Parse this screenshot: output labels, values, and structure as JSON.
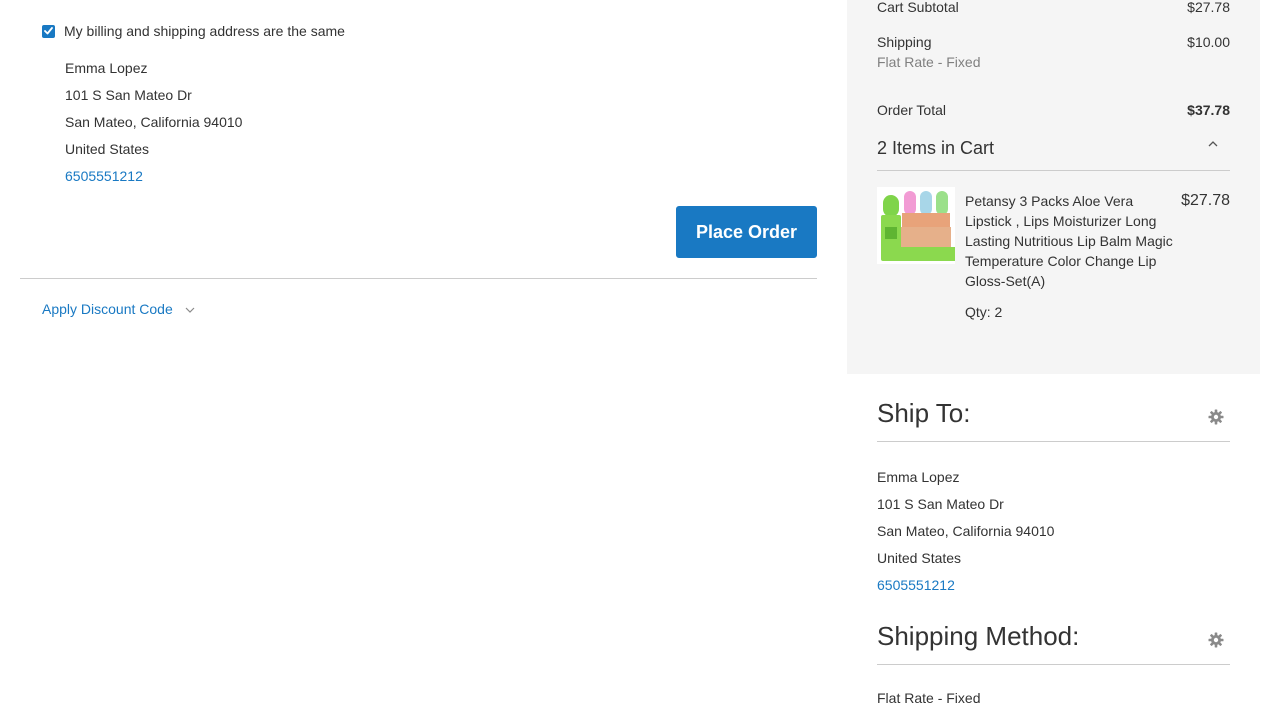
{
  "billing": {
    "same_address_label": "My billing and shipping address are the same",
    "address": {
      "name": "Emma Lopez",
      "street": "101 S San Mateo Dr",
      "city_line": "San Mateo, California 94010",
      "country": "United States",
      "phone": "6505551212"
    }
  },
  "actions": {
    "place_order_label": "Place Order",
    "discount_label": "Apply Discount Code"
  },
  "summary": {
    "subtotal_label": "Cart Subtotal",
    "subtotal_value": "$27.78",
    "shipping_label": "Shipping",
    "shipping_method": "Flat Rate - Fixed",
    "shipping_value": "$10.00",
    "total_label": "Order Total",
    "total_value": "$37.78",
    "items_title": "2 Items in Cart",
    "item": {
      "name": "Petansy 3 Packs Aloe Vera Lipstick , Lips Moisturizer Long Lasting Nutritious Lip Balm Magic Temperature Color Change Lip Gloss-Set(A)",
      "price": "$27.78",
      "qty": "Qty: 2"
    }
  },
  "ship_to": {
    "title": "Ship To:",
    "name": "Emma Lopez",
    "street": "101 S San Mateo Dr",
    "city_line": "San Mateo, California 94010",
    "country": "United States",
    "phone": "6505551212"
  },
  "shipping_method": {
    "title": "Shipping Method:",
    "value": "Flat Rate - Fixed"
  },
  "colors": {
    "accent": "#1979c3",
    "panel_bg": "#f5f5f5",
    "divider": "#cccccc"
  }
}
